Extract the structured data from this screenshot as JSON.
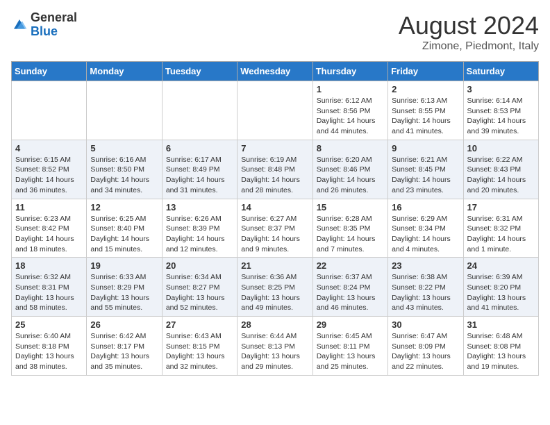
{
  "logo": {
    "general": "General",
    "blue": "Blue"
  },
  "title": {
    "month_year": "August 2024",
    "location": "Zimone, Piedmont, Italy"
  },
  "headers": [
    "Sunday",
    "Monday",
    "Tuesday",
    "Wednesday",
    "Thursday",
    "Friday",
    "Saturday"
  ],
  "weeks": [
    [
      {
        "day": "",
        "info": ""
      },
      {
        "day": "",
        "info": ""
      },
      {
        "day": "",
        "info": ""
      },
      {
        "day": "",
        "info": ""
      },
      {
        "day": "1",
        "info": "Sunrise: 6:12 AM\nSunset: 8:56 PM\nDaylight: 14 hours and 44 minutes."
      },
      {
        "day": "2",
        "info": "Sunrise: 6:13 AM\nSunset: 8:55 PM\nDaylight: 14 hours and 41 minutes."
      },
      {
        "day": "3",
        "info": "Sunrise: 6:14 AM\nSunset: 8:53 PM\nDaylight: 14 hours and 39 minutes."
      }
    ],
    [
      {
        "day": "4",
        "info": "Sunrise: 6:15 AM\nSunset: 8:52 PM\nDaylight: 14 hours and 36 minutes."
      },
      {
        "day": "5",
        "info": "Sunrise: 6:16 AM\nSunset: 8:50 PM\nDaylight: 14 hours and 34 minutes."
      },
      {
        "day": "6",
        "info": "Sunrise: 6:17 AM\nSunset: 8:49 PM\nDaylight: 14 hours and 31 minutes."
      },
      {
        "day": "7",
        "info": "Sunrise: 6:19 AM\nSunset: 8:48 PM\nDaylight: 14 hours and 28 minutes."
      },
      {
        "day": "8",
        "info": "Sunrise: 6:20 AM\nSunset: 8:46 PM\nDaylight: 14 hours and 26 minutes."
      },
      {
        "day": "9",
        "info": "Sunrise: 6:21 AM\nSunset: 8:45 PM\nDaylight: 14 hours and 23 minutes."
      },
      {
        "day": "10",
        "info": "Sunrise: 6:22 AM\nSunset: 8:43 PM\nDaylight: 14 hours and 20 minutes."
      }
    ],
    [
      {
        "day": "11",
        "info": "Sunrise: 6:23 AM\nSunset: 8:42 PM\nDaylight: 14 hours and 18 minutes."
      },
      {
        "day": "12",
        "info": "Sunrise: 6:25 AM\nSunset: 8:40 PM\nDaylight: 14 hours and 15 minutes."
      },
      {
        "day": "13",
        "info": "Sunrise: 6:26 AM\nSunset: 8:39 PM\nDaylight: 14 hours and 12 minutes."
      },
      {
        "day": "14",
        "info": "Sunrise: 6:27 AM\nSunset: 8:37 PM\nDaylight: 14 hours and 9 minutes."
      },
      {
        "day": "15",
        "info": "Sunrise: 6:28 AM\nSunset: 8:35 PM\nDaylight: 14 hours and 7 minutes."
      },
      {
        "day": "16",
        "info": "Sunrise: 6:29 AM\nSunset: 8:34 PM\nDaylight: 14 hours and 4 minutes."
      },
      {
        "day": "17",
        "info": "Sunrise: 6:31 AM\nSunset: 8:32 PM\nDaylight: 14 hours and 1 minute."
      }
    ],
    [
      {
        "day": "18",
        "info": "Sunrise: 6:32 AM\nSunset: 8:31 PM\nDaylight: 13 hours and 58 minutes."
      },
      {
        "day": "19",
        "info": "Sunrise: 6:33 AM\nSunset: 8:29 PM\nDaylight: 13 hours and 55 minutes."
      },
      {
        "day": "20",
        "info": "Sunrise: 6:34 AM\nSunset: 8:27 PM\nDaylight: 13 hours and 52 minutes."
      },
      {
        "day": "21",
        "info": "Sunrise: 6:36 AM\nSunset: 8:25 PM\nDaylight: 13 hours and 49 minutes."
      },
      {
        "day": "22",
        "info": "Sunrise: 6:37 AM\nSunset: 8:24 PM\nDaylight: 13 hours and 46 minutes."
      },
      {
        "day": "23",
        "info": "Sunrise: 6:38 AM\nSunset: 8:22 PM\nDaylight: 13 hours and 43 minutes."
      },
      {
        "day": "24",
        "info": "Sunrise: 6:39 AM\nSunset: 8:20 PM\nDaylight: 13 hours and 41 minutes."
      }
    ],
    [
      {
        "day": "25",
        "info": "Sunrise: 6:40 AM\nSunset: 8:18 PM\nDaylight: 13 hours and 38 minutes."
      },
      {
        "day": "26",
        "info": "Sunrise: 6:42 AM\nSunset: 8:17 PM\nDaylight: 13 hours and 35 minutes."
      },
      {
        "day": "27",
        "info": "Sunrise: 6:43 AM\nSunset: 8:15 PM\nDaylight: 13 hours and 32 minutes."
      },
      {
        "day": "28",
        "info": "Sunrise: 6:44 AM\nSunset: 8:13 PM\nDaylight: 13 hours and 29 minutes."
      },
      {
        "day": "29",
        "info": "Sunrise: 6:45 AM\nSunset: 8:11 PM\nDaylight: 13 hours and 25 minutes."
      },
      {
        "day": "30",
        "info": "Sunrise: 6:47 AM\nSunset: 8:09 PM\nDaylight: 13 hours and 22 minutes."
      },
      {
        "day": "31",
        "info": "Sunrise: 6:48 AM\nSunset: 8:08 PM\nDaylight: 13 hours and 19 minutes."
      }
    ]
  ]
}
